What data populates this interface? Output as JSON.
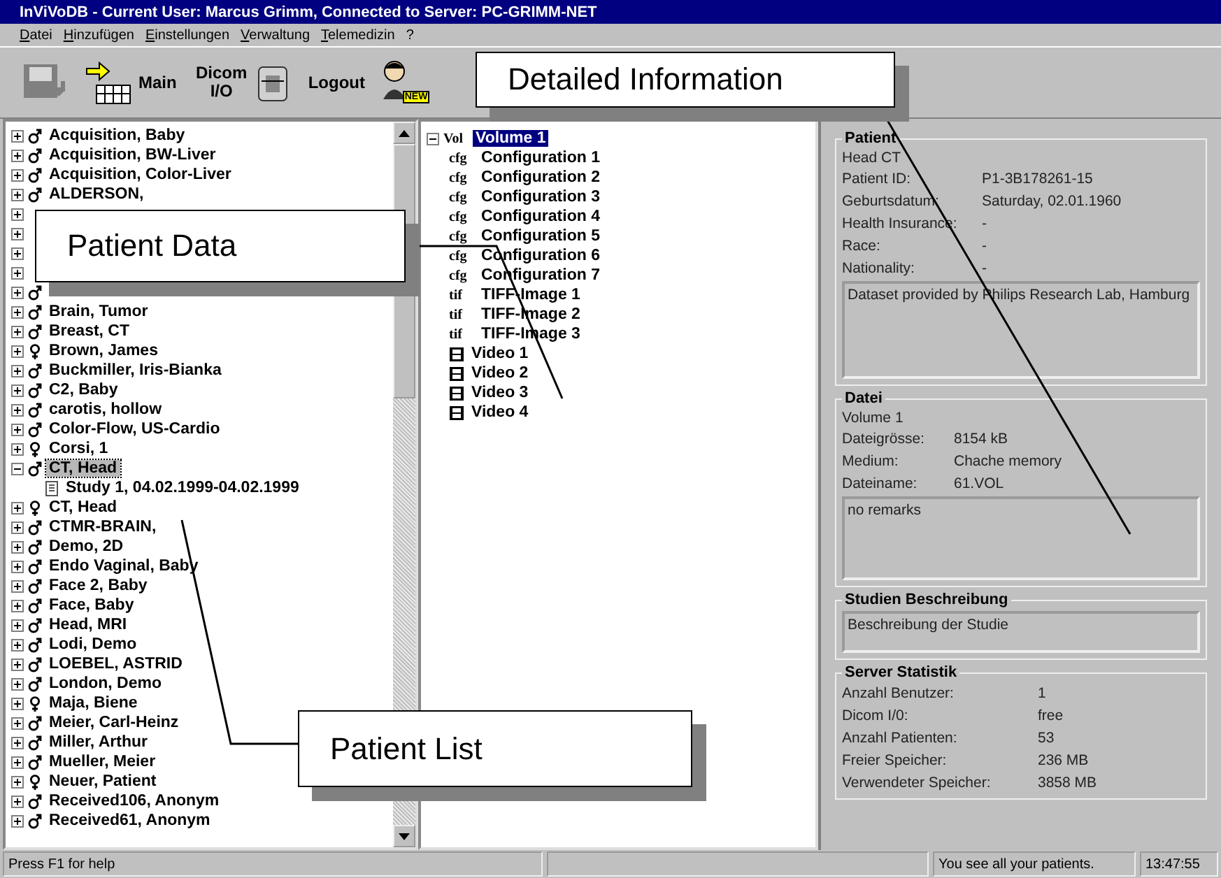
{
  "window": {
    "title": "InViVoDB - Current User: Marcus Grimm,  Connected to Server: PC-GRIMM-NET"
  },
  "menu": [
    "Datei",
    "Hinzufügen",
    "Einstellungen",
    "Verwaltung",
    "Telemedizin",
    "?"
  ],
  "toolbar": [
    {
      "kind": "disk",
      "disabled": true
    },
    {
      "kind": "main",
      "label": "Main"
    },
    {
      "kind": "dicom",
      "label": "Dicom I/O"
    },
    {
      "kind": "logout",
      "label": "Logout"
    },
    {
      "kind": "new-patient",
      "badge": "NEW"
    }
  ],
  "patient_list": [
    {
      "kind": "male",
      "name": "Acquisition, Baby",
      "expanded": false,
      "selected": false
    },
    {
      "kind": "male",
      "name": "Acquisition, BW-Liver",
      "expanded": false,
      "selected": false
    },
    {
      "kind": "male",
      "name": "Acquisition, Color-Liver",
      "expanded": false,
      "selected": false
    },
    {
      "kind": "male",
      "name": "ALDERSON,",
      "expanded": false,
      "selected": false
    },
    {
      "expanded": false
    },
    {
      "expanded": false
    },
    {
      "expanded": false
    },
    {
      "expanded": false
    },
    {
      "kind": "male",
      "expanded": false
    },
    {
      "kind": "male",
      "name": "Brain, Tumor",
      "expanded": false,
      "selected": false
    },
    {
      "kind": "male",
      "name": "Breast, CT",
      "expanded": false,
      "selected": false
    },
    {
      "kind": "female",
      "name": "Brown, James",
      "expanded": false,
      "selected": false
    },
    {
      "kind": "male",
      "name": "Buckmiller, Iris-Bianka",
      "expanded": false,
      "selected": false
    },
    {
      "kind": "male",
      "name": "C2, Baby",
      "expanded": false,
      "selected": false
    },
    {
      "kind": "male",
      "name": "carotis, hollow",
      "expanded": false,
      "selected": false
    },
    {
      "kind": "male",
      "name": "Color-Flow, US-Cardio",
      "expanded": false,
      "selected": false
    },
    {
      "kind": "female",
      "name": "Corsi, 1",
      "expanded": false,
      "selected": false
    },
    {
      "kind": "male",
      "name": "CT, Head",
      "expanded": true,
      "selected": true,
      "children": [
        {
          "name": "Study 1, 04.02.1999-04.02.1999"
        }
      ]
    },
    {
      "kind": "female",
      "name": "CT, Head",
      "expanded": false,
      "selected": false
    },
    {
      "kind": "male",
      "name": "CTMR-BRAIN,",
      "expanded": false,
      "selected": false
    },
    {
      "kind": "male",
      "name": "Demo, 2D",
      "expanded": false,
      "selected": false
    },
    {
      "kind": "male",
      "name": "Endo Vaginal, Baby",
      "expanded": false,
      "selected": false
    },
    {
      "kind": "male",
      "name": "Face 2, Baby",
      "expanded": false,
      "selected": false
    },
    {
      "kind": "male",
      "name": "Face, Baby",
      "expanded": false,
      "selected": false
    },
    {
      "kind": "male",
      "name": "Head, MRI",
      "expanded": false,
      "selected": false
    },
    {
      "kind": "male",
      "name": "Lodi, Demo",
      "expanded": false,
      "selected": false
    },
    {
      "kind": "male",
      "name": "LOEBEL, ASTRID",
      "expanded": false,
      "selected": false
    },
    {
      "kind": "male",
      "name": "London, Demo",
      "expanded": false,
      "selected": false
    },
    {
      "kind": "female",
      "name": "Maja, Biene",
      "expanded": false,
      "selected": false
    },
    {
      "kind": "male",
      "name": "Meier, Carl-Heinz",
      "expanded": false,
      "selected": false
    },
    {
      "kind": "male",
      "name": "Miller, Arthur",
      "expanded": false,
      "selected": false
    },
    {
      "kind": "male",
      "name": "Mueller, Meier",
      "expanded": false,
      "selected": false
    },
    {
      "kind": "female",
      "name": "Neuer, Patient",
      "expanded": false,
      "selected": false
    },
    {
      "kind": "male",
      "name": "Received106, Anonym",
      "expanded": false,
      "selected": false
    },
    {
      "kind": "male",
      "name": "Received61, Anonym",
      "expanded": false,
      "selected": false
    }
  ],
  "file_tree": {
    "badge": "Vol",
    "name": "Volume 1",
    "expanded": true,
    "selected": true,
    "children": [
      {
        "kind": "tag",
        "badge": "cfg",
        "name": "Configuration 1"
      },
      {
        "kind": "tag",
        "badge": "cfg",
        "name": "Configuration 2"
      },
      {
        "kind": "tag",
        "badge": "cfg",
        "name": "Configuration 3"
      },
      {
        "kind": "tag",
        "badge": "cfg",
        "name": "Configuration 4"
      },
      {
        "kind": "tag",
        "badge": "cfg",
        "name": "Configuration 5"
      },
      {
        "kind": "tag",
        "badge": "cfg",
        "name": "Configuration 6"
      },
      {
        "kind": "tag",
        "badge": "cfg",
        "name": "Configuration 7"
      },
      {
        "kind": "tag",
        "badge": "tif",
        "name": "TIFF-Image 1"
      },
      {
        "kind": "tag",
        "badge": "tif",
        "name": "TIFF-Image 2"
      },
      {
        "kind": "tag",
        "badge": "tif",
        "name": "TIFF-Image 3"
      },
      {
        "kind": "video",
        "name": "Video 1"
      },
      {
        "kind": "video",
        "name": "Video 2"
      },
      {
        "kind": "video",
        "name": "Video 3"
      },
      {
        "kind": "video",
        "name": "Video 4"
      }
    ]
  },
  "details": {
    "patient": {
      "title": "Patient",
      "name": "Head CT",
      "fields": [
        {
          "label": "Patient ID:",
          "value": "P1-3B178261-15"
        },
        {
          "label": "Geburtsdatum:",
          "value": "Saturday, 02.01.1960"
        },
        {
          "label": "Health Insurance:",
          "value": "-"
        },
        {
          "label": "Race:",
          "value": "-"
        },
        {
          "label": "Nationality:",
          "value": "-"
        }
      ],
      "notes": "Dataset provided by Philips Research Lab, Hamburg"
    },
    "file": {
      "title": "Datei",
      "name": "Volume 1",
      "fields": [
        {
          "label": "Dateigrösse:",
          "value": "8154 kB"
        },
        {
          "label": "Medium:",
          "value": "Chache memory"
        },
        {
          "label": "Dateiname:",
          "value": "61.VOL"
        }
      ],
      "notes": "no remarks"
    },
    "study": {
      "title": "Studien Beschreibung",
      "notes": "Beschreibung der Studie"
    },
    "server": {
      "title": "Server Statistik",
      "fields": [
        {
          "label": "Anzahl Benutzer:",
          "value": "1"
        },
        {
          "label": "Dicom I/0:",
          "value": "free"
        },
        {
          "label": "Anzahl Patienten:",
          "value": "53"
        },
        {
          "label": "Freier Speicher:",
          "value": "236 MB"
        },
        {
          "label": "Verwendeter Speicher:",
          "value": "3858 MB"
        }
      ]
    }
  },
  "status_bar": {
    "help": "Press F1 for help",
    "message": "You see all your patients.",
    "time": "13:47:55"
  },
  "callouts": [
    {
      "text": "Detailed Information"
    },
    {
      "text": "Patient Data"
    },
    {
      "text": "Patient List"
    }
  ]
}
